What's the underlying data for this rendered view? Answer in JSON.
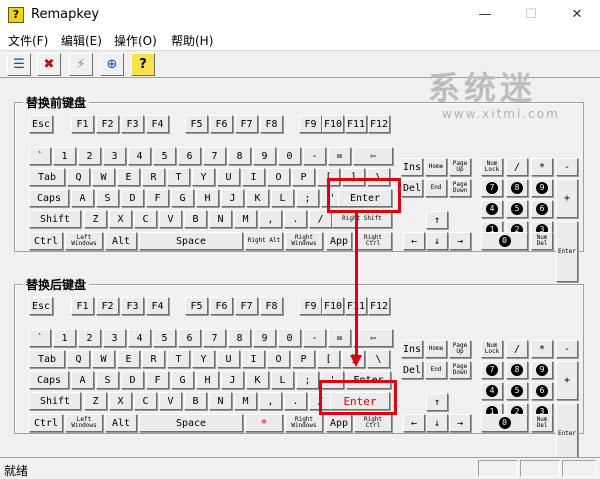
{
  "window": {
    "title": "Remapkey",
    "icon_glyph": "?",
    "minimize_glyph": "—",
    "maximize_glyph": "☐",
    "close_glyph": "✕"
  },
  "menu": [
    "文件(F)",
    "编辑(E)",
    "操作(O)",
    "帮助(H)"
  ],
  "toolbar": [
    {
      "name": "open-icon",
      "glyph": "☰"
    },
    {
      "name": "delete-icon",
      "glyph": "✖"
    },
    {
      "name": "lightning-icon",
      "glyph": "⚡"
    },
    {
      "name": "zoom-icon",
      "glyph": "⊕"
    },
    {
      "name": "help-icon",
      "glyph": "?"
    }
  ],
  "watermark": {
    "text": "系统迷",
    "url": "www.xitmi.com"
  },
  "groups": {
    "source": "替换前键盘",
    "target": "替换后键盘"
  },
  "status": "就绪",
  "highlight_color": "#e00010",
  "keyboard": {
    "esc": "Esc",
    "fkeys": [
      "F1",
      "F2",
      "F3",
      "F4",
      "F5",
      "F6",
      "F7",
      "F8",
      "F9",
      "F10",
      "F11",
      "F12"
    ],
    "row_num": [
      "`",
      "1",
      "2",
      "3",
      "4",
      "5",
      "6",
      "7",
      "8",
      "9",
      "0",
      "-",
      "=",
      "⇦"
    ],
    "row_q": [
      "Tab",
      "Q",
      "W",
      "E",
      "R",
      "T",
      "Y",
      "U",
      "I",
      "O",
      "P",
      "[",
      "]",
      "\\"
    ],
    "row_a": [
      "Caps",
      "A",
      "S",
      "D",
      "F",
      "G",
      "H",
      "J",
      "K",
      "L",
      ";",
      "'",
      "Enter"
    ],
    "row_z": [
      "Shift",
      "Z",
      "X",
      "C",
      "V",
      "B",
      "N",
      "M",
      ",",
      ".",
      "/",
      "Right Shift"
    ],
    "row_ctrl": [
      "Ctrl",
      "Left Windows",
      "Alt",
      "Space",
      "Right Alt",
      "Right Windows",
      "App",
      "Right Ctrl"
    ],
    "nav_top": [
      "Ins",
      "Home",
      "Page Up"
    ],
    "nav_bottom": [
      "Del",
      "End",
      "Page Down"
    ],
    "arrows": [
      "↑",
      "←",
      "↓",
      "→"
    ],
    "numpad": {
      "row1": [
        "Num Lock",
        "/",
        "*",
        "-"
      ],
      "row2": [
        "7",
        "8",
        "9"
      ],
      "row3": [
        "4",
        "5",
        "6"
      ],
      "row4": [
        "1",
        "2",
        "3"
      ],
      "row5": [
        "0",
        "Num Del"
      ],
      "plus": "+",
      "enter": "Enter"
    },
    "remapped_marker": "*",
    "remapped_enter": "Enter"
  }
}
